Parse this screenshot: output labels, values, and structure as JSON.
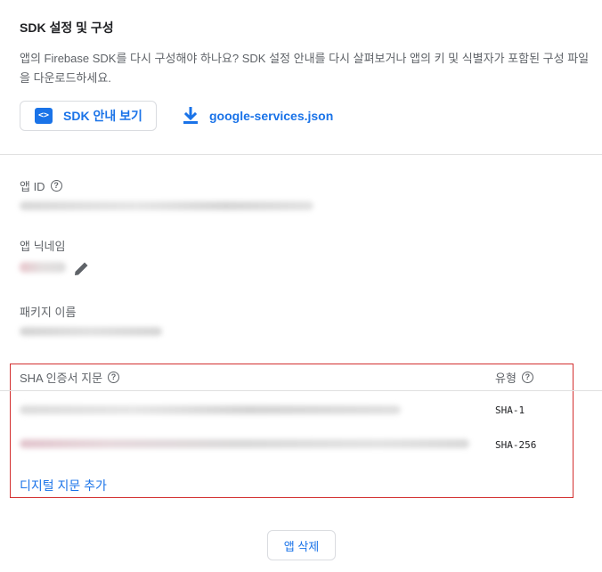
{
  "sdk_section": {
    "title": "SDK 설정 및 구성",
    "description": "앱의 Firebase SDK를 다시 구성해야 하나요? SDK 설정 안내를 다시 살펴보거나 앱의 키 및 식별자가 포함된 구성 파일을 다운로드하세요.",
    "guide_button": "SDK 안내 보기",
    "download_link": "google-services.json",
    "icon_code": "<>",
    "icons": {
      "guide": "code-icon",
      "download": "download-icon"
    }
  },
  "app_info": {
    "app_id_label": "앱 ID",
    "nickname_label": "앱 닉네임",
    "package_label": "패키지 이름",
    "help_glyph": "?"
  },
  "sha": {
    "header_label": "SHA 인증서 지문",
    "type_header": "유형",
    "rows": [
      {
        "type": "SHA-1"
      },
      {
        "type": "SHA-256"
      }
    ],
    "add_link": "디지털 지문 추가"
  },
  "actions": {
    "delete_app": "앱 삭제"
  },
  "colors": {
    "accent": "#1a73e8",
    "highlight_border": "#d32f2f",
    "muted_text": "#5f6368"
  }
}
